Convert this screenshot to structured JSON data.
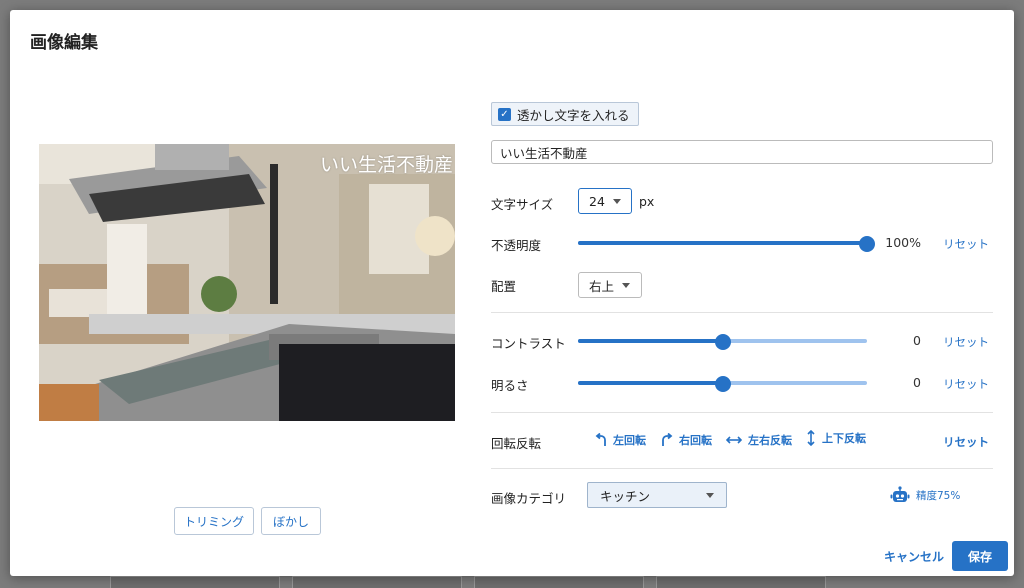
{
  "dialog": {
    "title": "画像編集"
  },
  "preview": {
    "watermark_text": "いい生活不動産"
  },
  "image_tools": {
    "trim_label": "トリミング",
    "blur_label": "ぼかし"
  },
  "watermark": {
    "checkbox_label": "透かし文字を入れる",
    "checked": true,
    "text_value": "いい生活不動産"
  },
  "font_size": {
    "label": "文字サイズ",
    "value": "24",
    "unit": "px"
  },
  "opacity": {
    "label": "不透明度",
    "value": 100,
    "display": "100%",
    "reset_label": "リセット"
  },
  "position": {
    "label": "配置",
    "value": "右上"
  },
  "contrast": {
    "label": "コントラスト",
    "value": 0,
    "display": "0",
    "reset_label": "リセット"
  },
  "brightness": {
    "label": "明るさ",
    "value": 0,
    "display": "0",
    "reset_label": "リセット"
  },
  "rotate": {
    "label": "回転反転",
    "left_label": "左回転",
    "right_label": "右回転",
    "flip_h_label": "左右反転",
    "flip_v_label": "上下反転",
    "reset_label": "リセット"
  },
  "category": {
    "label": "画像カテゴリ",
    "value": "キッチン",
    "ai_accuracy": "精度75%"
  },
  "footer": {
    "cancel_label": "キャンセル",
    "save_label": "保存"
  },
  "colors": {
    "accent": "#2672c6",
    "track_light": "#9fc3ee"
  }
}
